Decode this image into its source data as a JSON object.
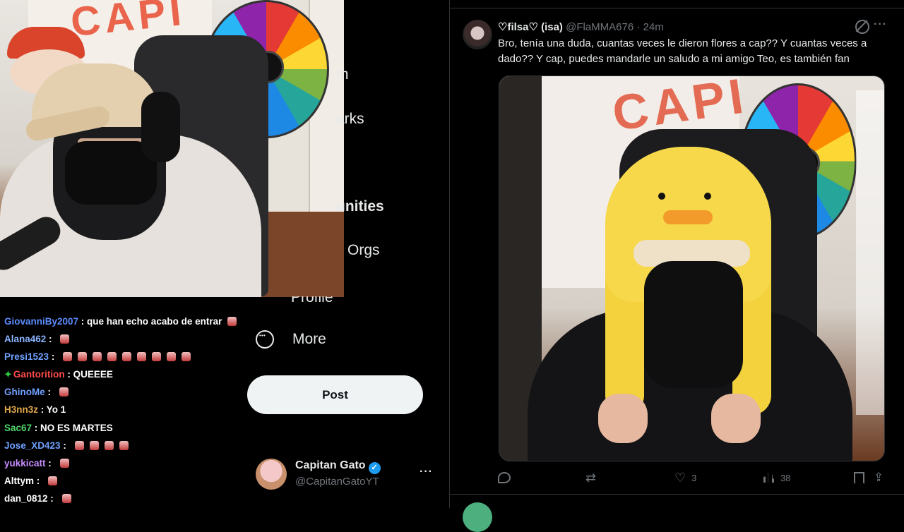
{
  "stream_chat": [
    {
      "user": "GiovanniBy2007",
      "color": "#5b8cff",
      "message": "que han echo acabo de entrar",
      "emotes": 1,
      "badge": false
    },
    {
      "user": "Alana462",
      "color": "#8ab4ff",
      "message": "",
      "emotes": 1,
      "badge": false
    },
    {
      "user": "Presi1523",
      "color": "#6fa0ff",
      "message": "",
      "emotes": 9,
      "badge": false
    },
    {
      "user": "Gantorition",
      "color": "#ff4b4b",
      "message": "QUEEEE",
      "emotes": 0,
      "badge": true
    },
    {
      "user": "GhinoMe",
      "color": "#6fa0ff",
      "message": "",
      "emotes": 1,
      "badge": false
    },
    {
      "user": "H3nn3z",
      "color": "#e0a84a",
      "message": "Yo 1",
      "emotes": 0,
      "badge": false
    },
    {
      "user": "Sac67",
      "color": "#4fd66b",
      "message": "NO ES MARTES",
      "emotes": 0,
      "badge": false
    },
    {
      "user": "Jose_XD423",
      "color": "#6fa0ff",
      "message": "",
      "emotes": 4,
      "badge": false
    },
    {
      "user": "yukkicatt",
      "color": "#c78cff",
      "message": "",
      "emotes": 1,
      "badge": false
    },
    {
      "user": "Alttym",
      "color": "#ffffff",
      "message": "",
      "emotes": 1,
      "badge": false
    },
    {
      "user": "dan_0812",
      "color": "#ffffff",
      "message": "",
      "emotes": 1,
      "badge": false
    }
  ],
  "sidebar": {
    "nav_fragments": [
      "m",
      "arks",
      "unities",
      "Orgs",
      "Profile"
    ],
    "more_label": "More",
    "post_button": "Post",
    "account": {
      "name": "Capitan Gato",
      "handle": "@CapitanGatoYT",
      "verified": true
    }
  },
  "tweet": {
    "display_name": "♡filsa♡ (isa)",
    "handle": "@FlaMMA676",
    "separator": "·",
    "time": "24m",
    "text": "Bro, tenía una duda, cuantas veces le dieron flores a cap?? Y cuantas veces a dado?? Y cap, puedes mandarle un saludo a mi amigo Teo, es también fan",
    "stats": {
      "replies": "",
      "reposts": "",
      "likes": "3",
      "views": "38"
    }
  },
  "webcam_banner_text": "CAPI",
  "colors": {
    "background": "#000000",
    "text_primary": "#e7e9ea",
    "text_secondary": "#71767b",
    "divider": "#2f3336",
    "verified": "#1d9bf0",
    "post_button_bg": "#eff3f4"
  },
  "icons": {
    "more": "more-circle-icon",
    "grok": "grok-icon",
    "reply": "reply-icon",
    "repost": "repost-icon",
    "like": "heart-icon",
    "views": "views-bar-chart-icon",
    "bookmark": "bookmark-icon",
    "share": "share-icon"
  }
}
